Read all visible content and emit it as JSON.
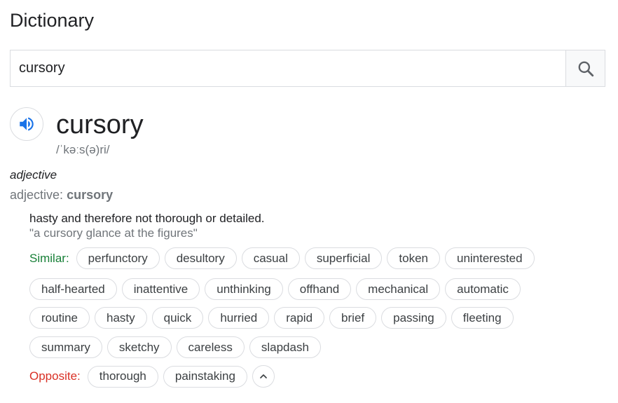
{
  "header": {
    "title": "Dictionary"
  },
  "search": {
    "value": "cursory"
  },
  "entry": {
    "word": "cursory",
    "phonetic": "/ˈkəːs(ə)ri/",
    "part_of_speech": "adjective",
    "form_label": "adjective:",
    "form_word": "cursory",
    "definition": "hasty and therefore not thorough or detailed.",
    "example": "\"a cursory glance at the figures\""
  },
  "similar": {
    "label": "Similar:",
    "rows": [
      [
        "perfunctory",
        "desultory",
        "casual",
        "superficial",
        "token",
        "uninterested"
      ],
      [
        "half-hearted",
        "inattentive",
        "unthinking",
        "offhand",
        "mechanical",
        "automatic"
      ],
      [
        "routine",
        "hasty",
        "quick",
        "hurried",
        "rapid",
        "brief",
        "passing",
        "fleeting"
      ],
      [
        "summary",
        "sketchy",
        "careless",
        "slapdash"
      ]
    ]
  },
  "opposite": {
    "label": "Opposite:",
    "words": [
      "thorough",
      "painstaking"
    ]
  },
  "colors": {
    "similar": "#188038",
    "opposite": "#d93025",
    "speaker": "#1a73e8"
  }
}
